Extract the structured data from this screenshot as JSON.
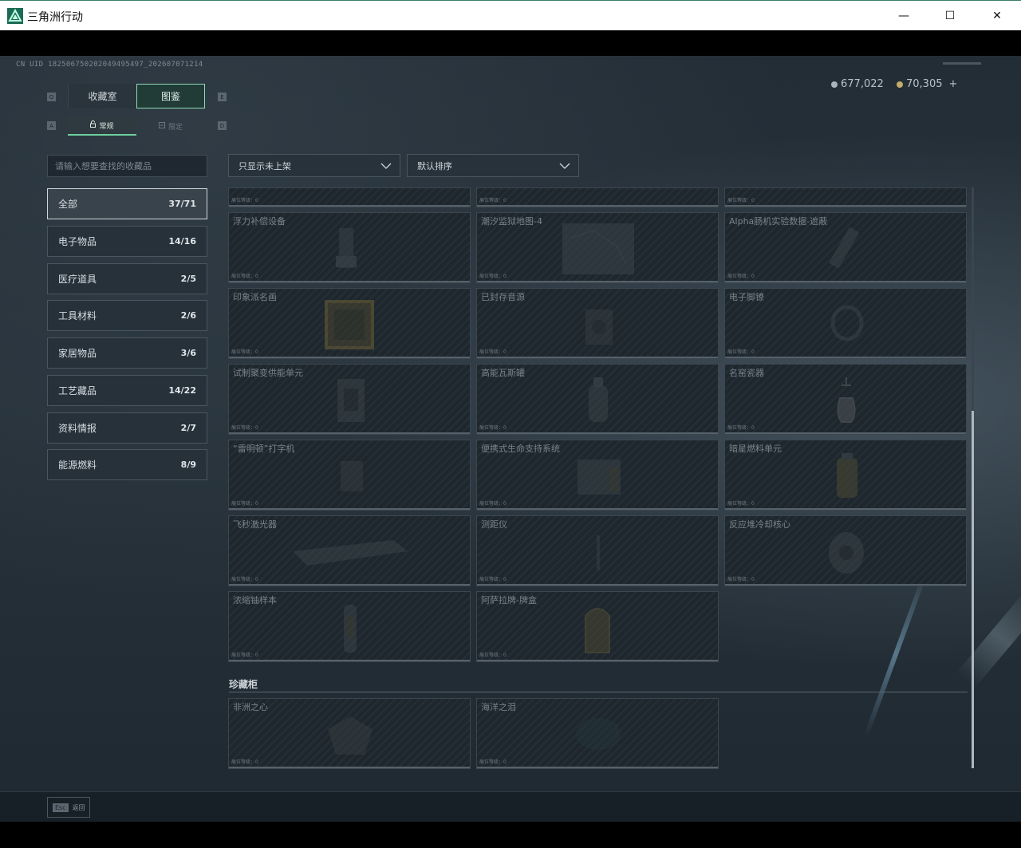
{
  "window": {
    "title": "三角洲行动",
    "minimize": "—",
    "maximize": "☐",
    "close": "✕"
  },
  "uid": "CN UID 182506750202049495497_202607071214",
  "currency": {
    "silver": "677,022",
    "gold": "70,305",
    "plus": "+"
  },
  "keys": {
    "q": "Q",
    "e": "E",
    "a": "A",
    "d": "D"
  },
  "tabs": {
    "collection": "收藏室",
    "encyclopedia": "图鉴"
  },
  "subtabs": {
    "normal": "常规",
    "limited": "限定"
  },
  "search": {
    "placeholder": "请输入想要查找的收藏品"
  },
  "categories": [
    {
      "label": "全部",
      "count": "37/71"
    },
    {
      "label": "电子物品",
      "count": "14/16"
    },
    {
      "label": "医疗道具",
      "count": "2/5"
    },
    {
      "label": "工具材料",
      "count": "2/6"
    },
    {
      "label": "家居物品",
      "count": "3/6"
    },
    {
      "label": "工艺藏品",
      "count": "14/22"
    },
    {
      "label": "资料情报",
      "count": "2/7"
    },
    {
      "label": "能源燃料",
      "count": "8/9"
    }
  ],
  "filters": {
    "show": "只显示未上架",
    "sort": "默认排序"
  },
  "card_sub": "展位等级：0",
  "items": [
    {
      "name": ""
    },
    {
      "name": ""
    },
    {
      "name": ""
    },
    {
      "name": "浮力补偿设备"
    },
    {
      "name": "潮汐监狱地图-4"
    },
    {
      "name": "Alpha肠机实验数据-遮蔽"
    },
    {
      "name": "印象派名画"
    },
    {
      "name": "已封存音源"
    },
    {
      "name": "电子脚镣"
    },
    {
      "name": "试制聚变供能单元"
    },
    {
      "name": "高能瓦斯罐"
    },
    {
      "name": "名窑瓷器"
    },
    {
      "name": "“雷明顿”打字机"
    },
    {
      "name": "便携式生命支持系统"
    },
    {
      "name": "暗星燃料单元"
    },
    {
      "name": "飞秒激光器"
    },
    {
      "name": "测距仪"
    },
    {
      "name": "反应堆冷却核心"
    },
    {
      "name": "浓缩铀样本"
    },
    {
      "name": "阿萨拉牌-牌盒"
    }
  ],
  "section": {
    "title": "珍藏柜"
  },
  "treasures": [
    {
      "name": "非洲之心"
    },
    {
      "name": "海洋之泪"
    }
  ],
  "footer": {
    "esc_key": "Esc",
    "back": "返回"
  }
}
